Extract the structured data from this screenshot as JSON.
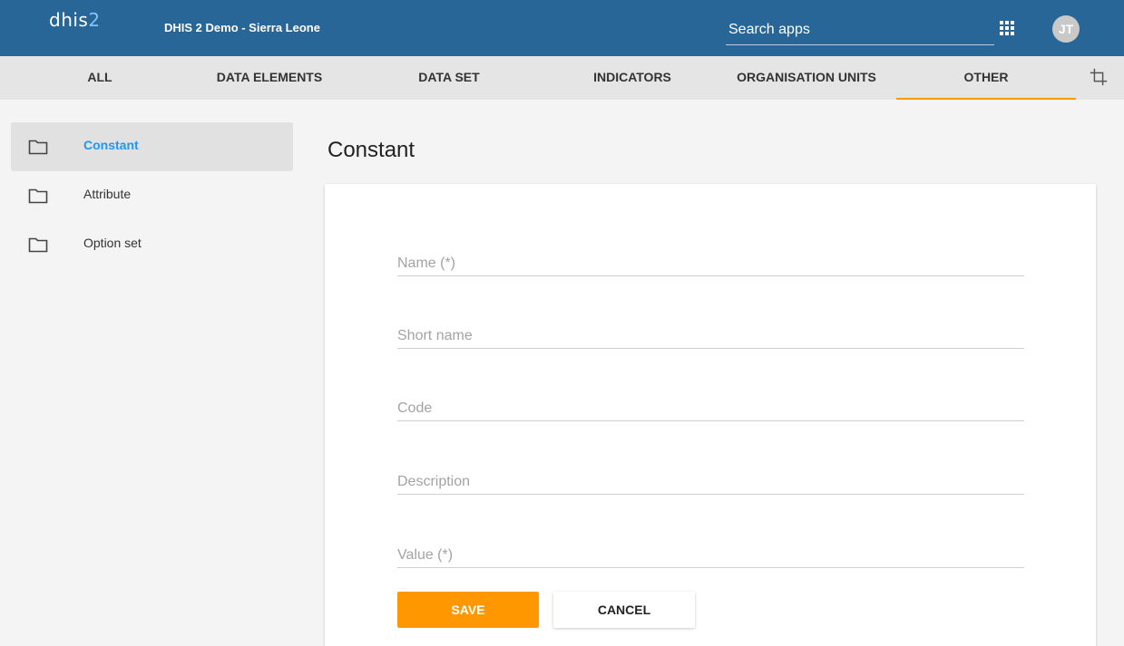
{
  "header": {
    "logo_prefix": "dhis",
    "logo_num": "2",
    "instance_name": "DHIS 2 Demo - Sierra Leone",
    "search_placeholder": "Search apps",
    "apps_icon": "apps-grid-icon",
    "avatar_initials": "JT",
    "color": "#276696"
  },
  "tabs": [
    {
      "label": "ALL"
    },
    {
      "label": "DATA ELEMENTS"
    },
    {
      "label": "DATA SET"
    },
    {
      "label": "INDICATORS"
    },
    {
      "label": "ORGANISATION UNITS"
    },
    {
      "label": "OTHER",
      "active": true
    }
  ],
  "tab_accent": "#ff9800",
  "sidebar": {
    "items": [
      {
        "label": "Constant",
        "icon": "folder-icon",
        "active": true
      },
      {
        "label": "Attribute",
        "icon": "folder-icon"
      },
      {
        "label": "Option set",
        "icon": "folder-icon"
      }
    ]
  },
  "main": {
    "title": "Constant",
    "fields": [
      {
        "placeholder": "Name (*)",
        "value": ""
      },
      {
        "placeholder": "Short name",
        "value": ""
      },
      {
        "placeholder": "Code",
        "value": ""
      },
      {
        "placeholder": "Description",
        "value": ""
      },
      {
        "placeholder": "Value (*)",
        "value": ""
      }
    ],
    "save_label": "SAVE",
    "cancel_label": "CANCEL"
  }
}
